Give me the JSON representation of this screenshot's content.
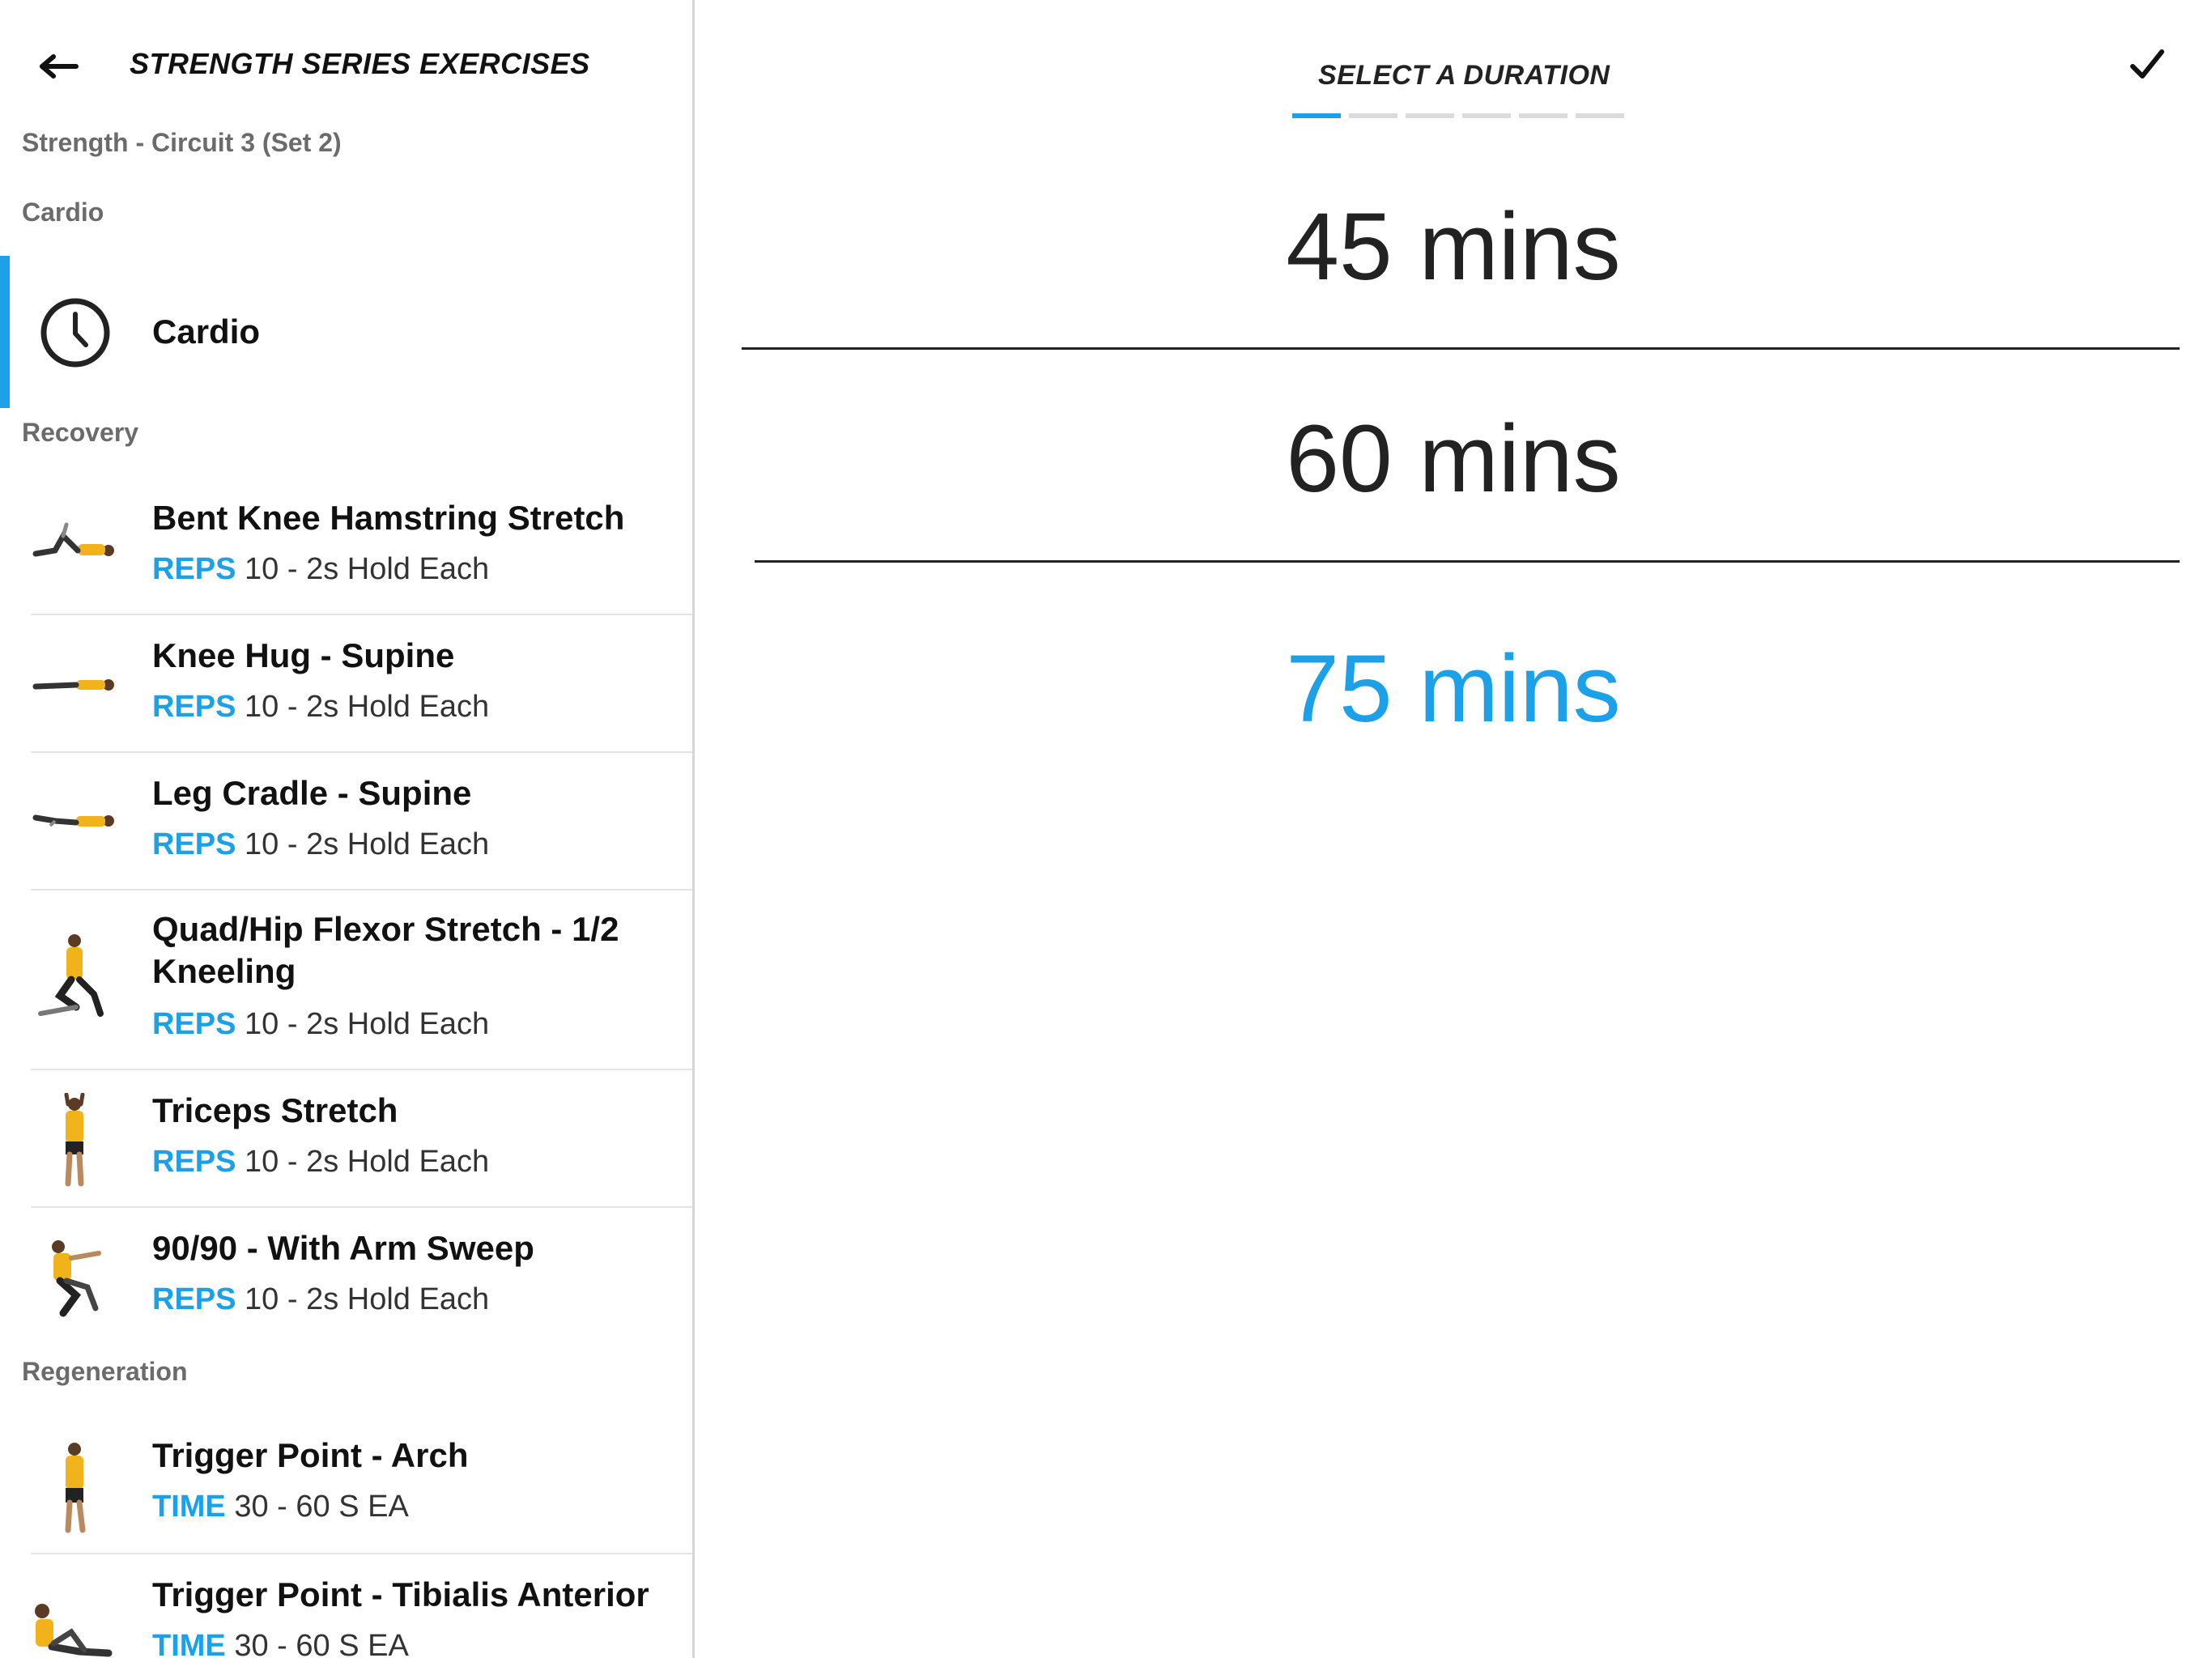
{
  "header": {
    "title": "STRENGTH SERIES EXERCISES"
  },
  "sections": {
    "strength_circuit": "Strength - Circuit 3 (Set 2)",
    "cardio_header": "Cardio",
    "recovery_header": "Recovery",
    "regeneration_header": "Regeneration"
  },
  "cardio_item": {
    "label": "Cardio",
    "icon": "clock-icon"
  },
  "exercises": [
    {
      "name": "Bent Knee Hamstring Stretch",
      "metric": "REPS",
      "value": "10 - 2s Hold Each"
    },
    {
      "name": "Knee Hug - Supine",
      "metric": "REPS",
      "value": "10 - 2s Hold Each"
    },
    {
      "name": "Leg Cradle - Supine",
      "metric": "REPS",
      "value": "10 - 2s Hold Each"
    },
    {
      "name": "Quad/Hip Flexor Stretch - 1/2 Kneeling",
      "metric": "REPS",
      "value": "10 - 2s Hold Each"
    },
    {
      "name": "Triceps Stretch",
      "metric": "REPS",
      "value": "10 - 2s Hold Each"
    },
    {
      "name": "90/90 - With Arm Sweep",
      "metric": "REPS",
      "value": "10 - 2s Hold Each"
    },
    {
      "name": "Trigger Point - Arch",
      "metric": "TIME",
      "value": "30 - 60 S EA"
    },
    {
      "name": "Trigger Point - Tibialis Anterior",
      "metric": "TIME",
      "value": "30 - 60 S EA"
    }
  ],
  "duration_picker": {
    "title": "SELECT A DURATION",
    "options": [
      "45 mins",
      "60 mins",
      "75 mins"
    ],
    "selected": "75 mins",
    "step_current": 1,
    "step_total": 6
  },
  "colors": {
    "accent": "#1ca0e8",
    "shirt": "#f2b21b",
    "text": "#111111"
  }
}
